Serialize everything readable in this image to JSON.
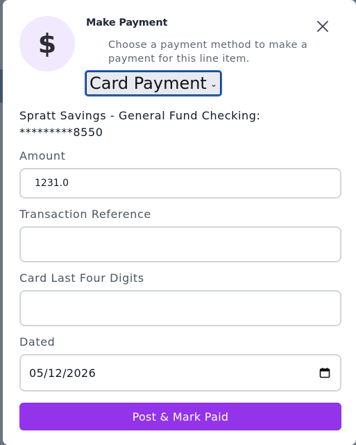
{
  "modal": {
    "icon": "dollar-icon",
    "icon_glyph": "$",
    "title": "Make Payment",
    "subtitle": "Choose a payment method to make a payment for this line item.",
    "close_icon": "close-icon"
  },
  "payment_method": {
    "selected": "Card Payment"
  },
  "account_line": "Spratt Savings - General Fund Checking: *********8550",
  "form": {
    "amount_label": "Amount",
    "amount_value": "1231.0",
    "reference_label": "Transaction Reference",
    "reference_value": "",
    "card_label": "Card Last Four Digits",
    "card_value": "",
    "dated_label": "Dated",
    "dated_value": "05/12/2026"
  },
  "submit_label": "Post & Mark Paid",
  "colors": {
    "accent": "#9333ea",
    "icon_bg": "#f1e9fd",
    "overlay": "#6b7280"
  }
}
